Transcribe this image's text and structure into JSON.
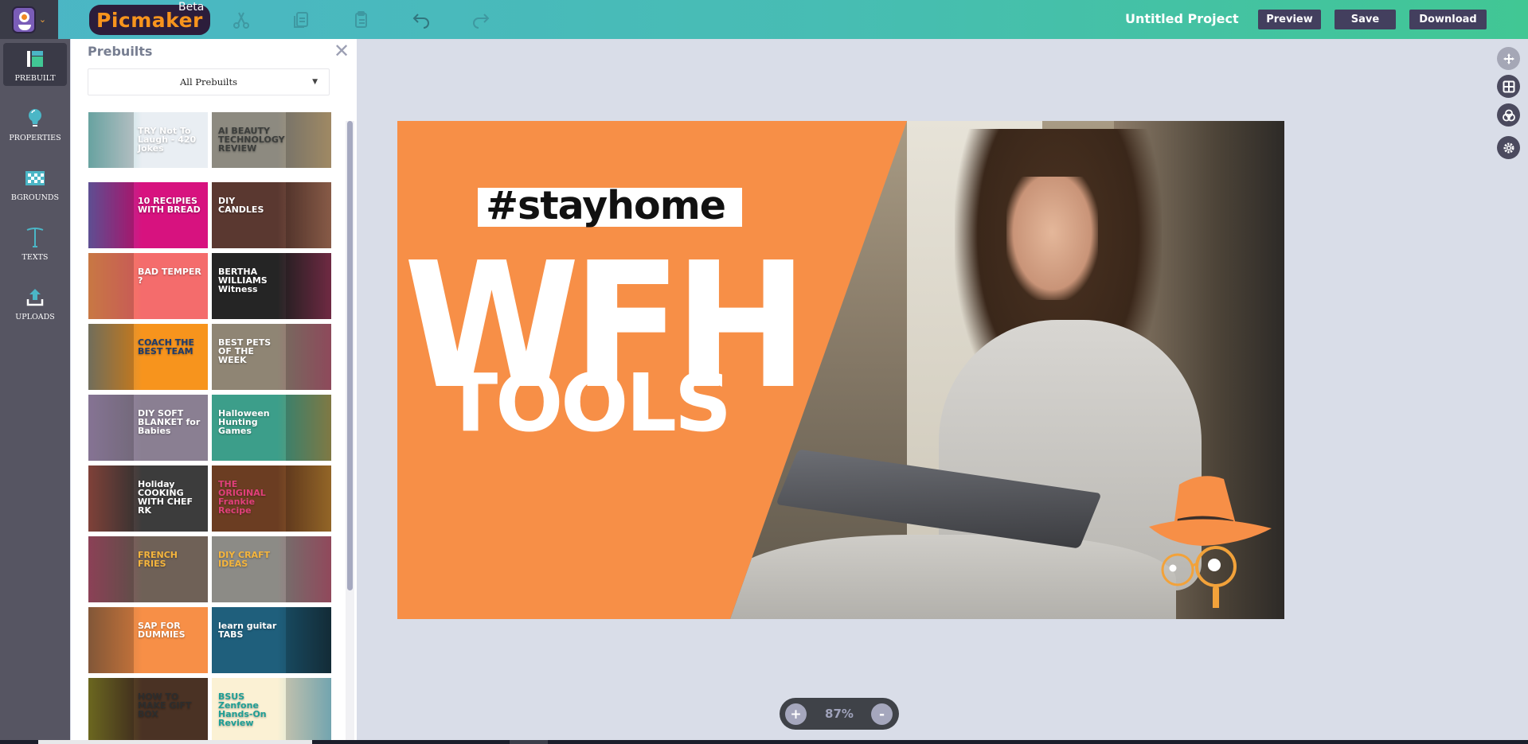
{
  "topbar": {
    "app_name": "Picmaker",
    "beta_label": "Beta",
    "project_title": "Untitled Project",
    "buttons": {
      "preview": "Preview",
      "save": "Save",
      "download": "Download"
    },
    "tools": [
      "cut-icon",
      "copy-icon",
      "paste-icon",
      "undo-icon",
      "redo-icon"
    ],
    "colors": {
      "gradient_start": "#4bb6c6",
      "gradient_end": "#41c794",
      "button_bg": "#433f5e"
    }
  },
  "sidebar": {
    "items": [
      {
        "label": "PREBUILT",
        "icon": "layout-icon",
        "active": true
      },
      {
        "label": "PROPERTIES",
        "icon": "bulb-icon",
        "active": false
      },
      {
        "label": "BGROUNDS",
        "icon": "pattern-icon",
        "active": false
      },
      {
        "label": "TEXTS",
        "icon": "text-icon",
        "active": false
      },
      {
        "label": "UPLOADS",
        "icon": "upload-icon",
        "active": false
      }
    ]
  },
  "panel": {
    "title": "Prebuilts",
    "filter_selected": "All Prebuilts",
    "templates": [
      {
        "title": "TRY Not To Laugh - 420 Jokes",
        "bg": "#e9eef3",
        "fg": "#ffffff",
        "accent": "#21a39a"
      },
      {
        "title": "AI BEAUTY TECHNOLOGY REVIEW",
        "bg": "#8d8a80",
        "fg": "#3c3e3c",
        "accent": "#f3c276"
      },
      {
        "title": "10 RECIPIES WITH BREAD",
        "bg": "#d7127f",
        "fg": "#ffffff",
        "accent": "#1aa6e0"
      },
      {
        "title": "DIY CANDLES",
        "bg": "#5a3830",
        "fg": "#ffffff",
        "accent": "#e9a07a"
      },
      {
        "title": "BAD TEMPER ?",
        "bg": "#f46c6c",
        "fg": "#ffffff",
        "accent": "#f5b53d"
      },
      {
        "title": "BERTHA WILLIAMS Witness",
        "bg": "#252525",
        "fg": "#ffffff",
        "accent": "#e0407a"
      },
      {
        "title": "COACH THE BEST TEAM",
        "bg": "#f7941d",
        "fg": "#1d3c6e",
        "accent": "#2a7ab8"
      },
      {
        "title": "BEST PETS OF THE WEEK",
        "bg": "#8f8574",
        "fg": "#ffffff",
        "accent": "#c8336c"
      },
      {
        "title": "DIY SOFT BLANKET for Babies",
        "bg": "#8a7f92",
        "fg": "#ffffff",
        "accent": "#b99ad3"
      },
      {
        "title": "Halloween Hunting Games",
        "bg": "#3c9e8a",
        "fg": "#ffffff",
        "accent": "#f18a22"
      },
      {
        "title": "Holiday COOKING WITH CHEF RK",
        "bg": "#3c3c3c",
        "fg": "#ffffff",
        "accent": "#f0624f"
      },
      {
        "title": "THE ORIGINAL Frankie Recipe",
        "bg": "#6b3d22",
        "fg": "#e0407a",
        "accent": "#f5b53d"
      },
      {
        "title": "FRENCH FRIES",
        "bg": "#6f6157",
        "fg": "#f5b53d",
        "accent": "#e0407a"
      },
      {
        "title": "DIY CRAFT IDEAS",
        "bg": "#8c8b86",
        "fg": "#f5b53d",
        "accent": "#d22c5c"
      },
      {
        "title": "SAP FOR DUMMIES",
        "bg": "#f78f47",
        "fg": "#ffffff",
        "accent": "#514a42"
      },
      {
        "title": "learn guitar TABS",
        "bg": "#1f5f7c",
        "fg": "#ffffff",
        "accent": "#111111"
      },
      {
        "title": "HOW TO MAKE GIFT BOX",
        "bg": "#4a3224",
        "fg": "#2d2d2d",
        "accent": "#b6c22a"
      },
      {
        "title": "BSUS Zenfone Hands-On Review",
        "bg": "#fbf1d4",
        "fg": "#1e9f96",
        "accent": "#2aa6d8"
      }
    ]
  },
  "canvas": {
    "hashtag": "#stayhome",
    "headline": "WFH",
    "subheadline": "TOOLS",
    "bg_color": "#f78f47",
    "logo": "detective-hat-glasses-icon"
  },
  "right_tools": [
    {
      "icon": "move-icon",
      "enabled": false
    },
    {
      "icon": "grid-icon",
      "enabled": true
    },
    {
      "icon": "color-blend-icon",
      "enabled": true
    },
    {
      "icon": "settings-icon",
      "enabled": true
    }
  ],
  "zoom": {
    "value": "87%",
    "zoom_in_label": "+",
    "zoom_out_label": "-"
  }
}
